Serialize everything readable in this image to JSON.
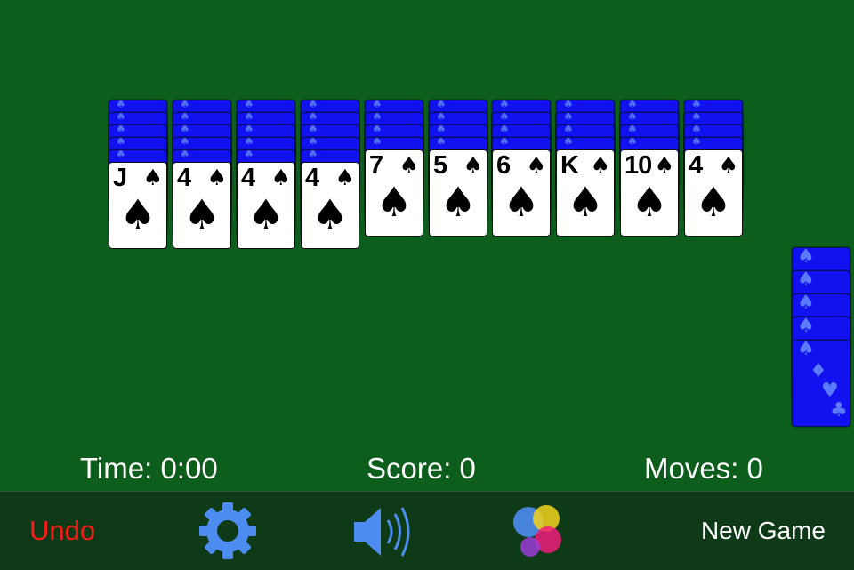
{
  "piles": [
    {
      "hidden": 5,
      "top": {
        "rank": "J",
        "suit": "♠"
      }
    },
    {
      "hidden": 5,
      "top": {
        "rank": "4",
        "suit": "♠"
      }
    },
    {
      "hidden": 5,
      "top": {
        "rank": "4",
        "suit": "♠"
      }
    },
    {
      "hidden": 5,
      "top": {
        "rank": "4",
        "suit": "♠"
      }
    },
    {
      "hidden": 4,
      "top": {
        "rank": "7",
        "suit": "♠"
      }
    },
    {
      "hidden": 4,
      "top": {
        "rank": "5",
        "suit": "♠"
      }
    },
    {
      "hidden": 4,
      "top": {
        "rank": "6",
        "suit": "♠"
      }
    },
    {
      "hidden": 4,
      "top": {
        "rank": "K",
        "suit": "♠"
      }
    },
    {
      "hidden": 4,
      "top": {
        "rank": "10",
        "suit": "♠"
      }
    },
    {
      "hidden": 4,
      "top": {
        "rank": "4",
        "suit": "♠"
      }
    }
  ],
  "stock": {
    "deals_remaining": 5
  },
  "status": {
    "time": "Time: 0:00",
    "score": "Score: 0",
    "moves": "Moves: 0"
  },
  "toolbar": {
    "undo_label": "Undo",
    "settings_icon": "gear-icon",
    "sound_icon": "speaker-icon",
    "game_center_icon": "game-center-icon",
    "new_game_label": "New Game"
  },
  "colors": {
    "table": "#0d5e1c",
    "toolbar": "#0f3a17",
    "card_back": "#1212f0",
    "undo": "#ff1a1a",
    "icon_blue": "#4d8cf0"
  }
}
